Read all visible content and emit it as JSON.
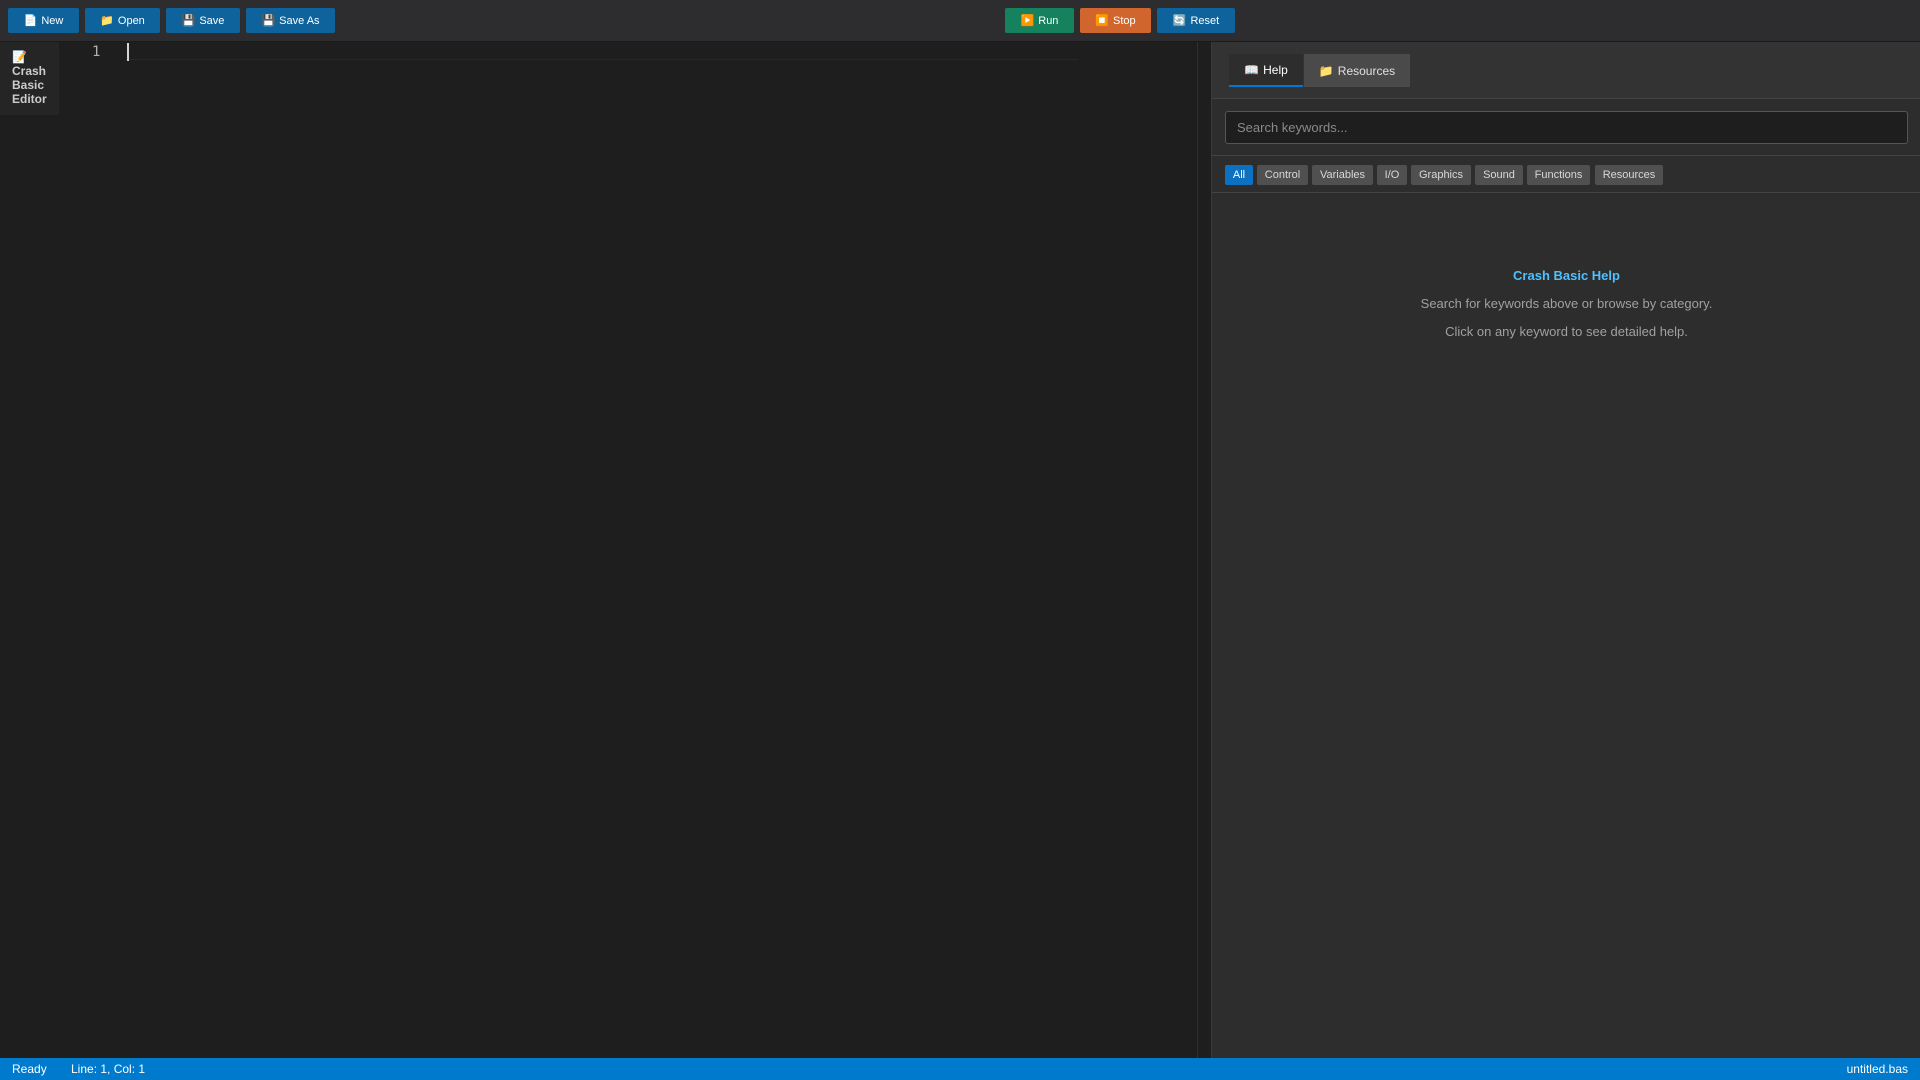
{
  "toolbar": {
    "new_label": "New",
    "open_label": "Open",
    "save_label": "Save",
    "save_as_label": "Save As",
    "run_label": "Run",
    "stop_label": "Stop",
    "reset_label": "Reset",
    "icons": {
      "new": "📄",
      "open": "📁",
      "save": "💾",
      "save_as": "💾",
      "run": "▶️",
      "stop": "⏹️",
      "reset": "🔄"
    }
  },
  "editor": {
    "label_icon": "📝",
    "label": "Crash Basic Editor",
    "line_number": "1",
    "code": ""
  },
  "help_panel": {
    "tabs": [
      {
        "icon": "📖",
        "label": "Help",
        "active": true
      },
      {
        "icon": "📁",
        "label": "Resources",
        "active": false
      }
    ],
    "search_placeholder": "Search keywords...",
    "search_value": "",
    "categories": [
      "All",
      "Control",
      "Variables",
      "I/O",
      "Graphics",
      "Sound",
      "Functions",
      "Resources"
    ],
    "active_category": "All",
    "title": "Crash Basic Help",
    "lines": [
      "Search for keywords above or browse by category.",
      "Click on any keyword to see detailed help."
    ]
  },
  "status": {
    "state": "Ready",
    "position": "Line: 1, Col: 1",
    "filename": "untitled.bas"
  },
  "colors": {
    "accent": "#007acc",
    "run": "#16825d",
    "stop": "#d0662e",
    "help_title": "#4fc1ff"
  }
}
